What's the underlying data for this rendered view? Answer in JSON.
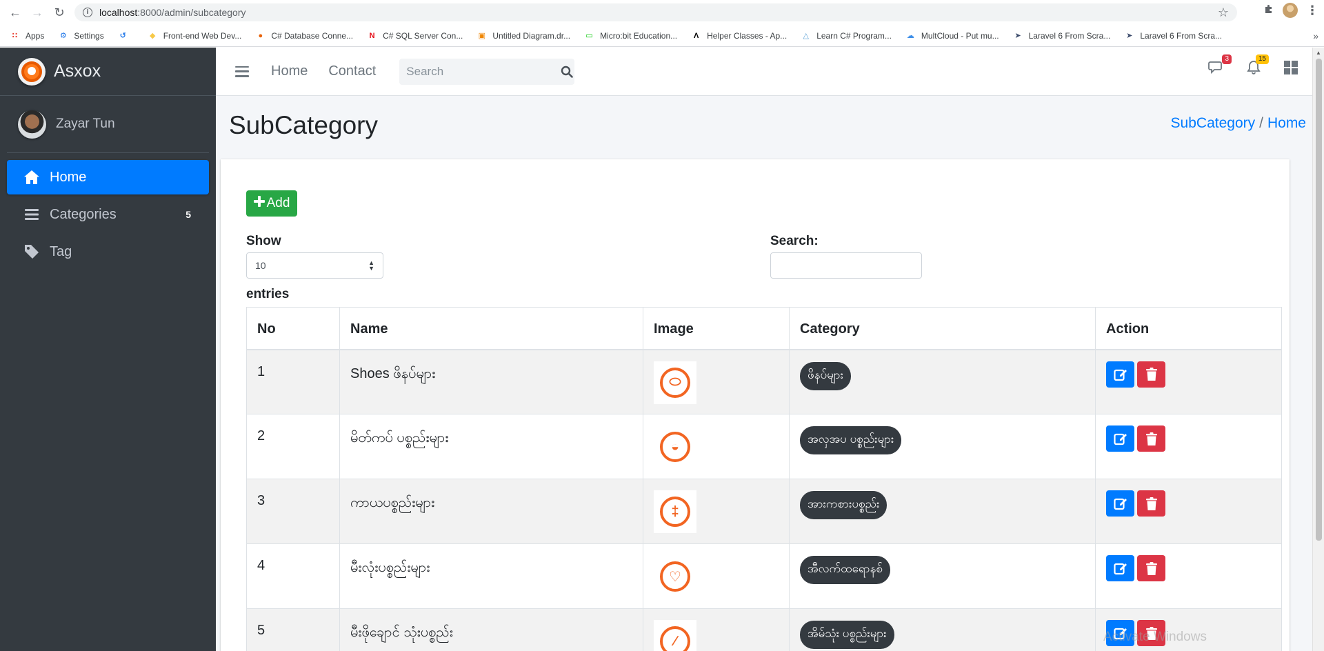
{
  "browser": {
    "url_host": "localhost",
    "url_path": ":8000/admin/subcategory",
    "bookmarks": [
      {
        "label": "Apps",
        "icon": "apps-grid-icon",
        "color": "#ea4335"
      },
      {
        "label": "Settings",
        "icon": "gear-icon",
        "color": "#1a73e8"
      },
      {
        "label": "",
        "icon": "history-icon",
        "color": "#1a73e8"
      },
      {
        "label": "Front-end Web Dev...",
        "icon": "python-icon",
        "color": "#f7c948"
      },
      {
        "label": "C# Database Conne...",
        "icon": "csharp-site-icon",
        "color": "#e8630a"
      },
      {
        "label": "C# SQL Server Con...",
        "icon": "n-logo-icon",
        "color": "#e50914"
      },
      {
        "label": "Untitled Diagram.dr...",
        "icon": "drawio-icon",
        "color": "#f08705"
      },
      {
        "label": "Micro:bit Education...",
        "icon": "microbit-icon",
        "color": "#00c800"
      },
      {
        "label": "Helper Classes - Ap...",
        "icon": "apex-icon",
        "color": "#000000"
      },
      {
        "label": "Learn C# Program...",
        "icon": "learn-icon",
        "color": "#5aa0d6"
      },
      {
        "label": "MultCloud - Put mu...",
        "icon": "cloud-icon",
        "color": "#3d8ee8"
      },
      {
        "label": "Laravel 6 From Scra...",
        "icon": "paper-plane-icon",
        "color": "#3b4b6b"
      },
      {
        "label": "Laravel 6 From Scra...",
        "icon": "paper-plane-icon",
        "color": "#3b4b6b"
      }
    ]
  },
  "sidebar": {
    "brand": "Asxox",
    "user_name": "Zayar Tun",
    "items": [
      {
        "label": "Home",
        "icon": "home-icon",
        "active": true,
        "badge": ""
      },
      {
        "label": "Categories",
        "icon": "list-icon",
        "active": false,
        "badge": "5"
      },
      {
        "label": "Tag",
        "icon": "tag-icon",
        "active": false,
        "badge": ""
      }
    ]
  },
  "topnav": {
    "links": [
      "Home",
      "Contact"
    ],
    "search_placeholder": "Search",
    "messages_badge": "3",
    "notifications_badge": "15"
  },
  "page": {
    "title": "SubCategory",
    "breadcrumb": {
      "current": "SubCategory",
      "sep": "/",
      "home": "Home"
    }
  },
  "toolbar": {
    "add_label": "Add",
    "show_label": "Show",
    "entries_value": "10",
    "entries_label": "entries",
    "search_label": "Search:"
  },
  "table": {
    "headers": [
      "No",
      "Name",
      "Image",
      "Category",
      "Action"
    ],
    "rows": [
      {
        "no": "1",
        "name": "Shoes ဖိနပ်များ",
        "image_icon": "shoe-icon",
        "category": "ဖိနပ်များ"
      },
      {
        "no": "2",
        "name": "မိတ်ကပ် ပစ္စည်းများ",
        "image_icon": "makeup-icon",
        "category": "အလှအပ ပစ္စည်းများ"
      },
      {
        "no": "3",
        "name": "ကာယပစ္စည်းများ",
        "image_icon": "dumbbell-icon",
        "category": "အားကစားပစ္စည်း"
      },
      {
        "no": "4",
        "name": "မီးလုံးပစ္စည်းများ",
        "image_icon": "lightbulb-icon",
        "category": "အီလက်ထရောနစ်"
      },
      {
        "no": "5",
        "name": "မီးဖိုချောင် သုံးပစ္စည်း",
        "image_icon": "kitchen-icon",
        "category": "အိမ်သုံး ပစ္စည်းများ"
      }
    ]
  },
  "watermark": "Activate Windows",
  "colors": {
    "sidebar_bg": "#343a40",
    "primary": "#007bff",
    "success": "#28a745",
    "danger": "#dc3545",
    "warning": "#ffc107",
    "image_accent": "#f26522"
  }
}
